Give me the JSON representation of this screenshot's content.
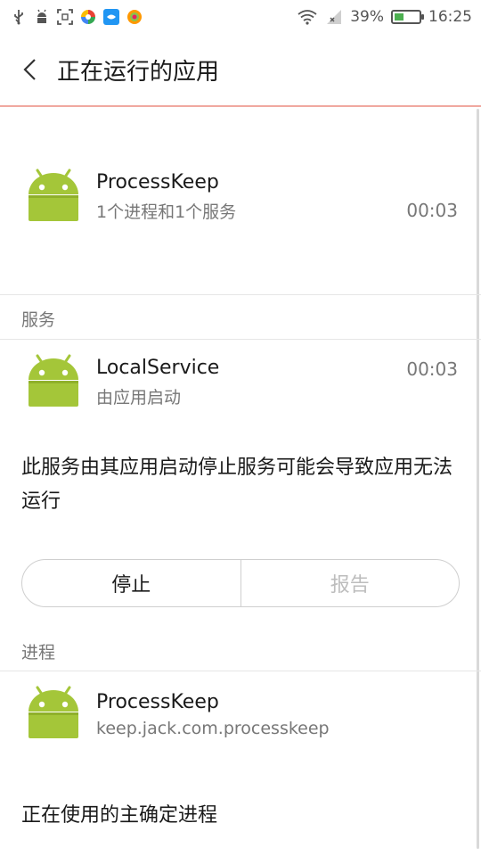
{
  "statusbar": {
    "battery_text": "39%",
    "battery_level": 0.39,
    "time": "16:25",
    "icons": [
      "usb-icon",
      "android-debug-icon",
      "screenshot-icon",
      "app-notify-icon-1",
      "app-notify-icon-2",
      "app-notify-icon-3",
      "wifi-icon",
      "signal-icon"
    ]
  },
  "header": {
    "title": "正在运行的应用"
  },
  "app": {
    "name": "ProcessKeep",
    "summary": "1个进程和1个服务",
    "time": "00:03"
  },
  "services": {
    "section_label": "服务",
    "item": {
      "name": "LocalService",
      "sub": "由应用启动",
      "time": "00:03"
    },
    "description": "此服务由其应用启动停止服务可能会导致应用无法运行",
    "stop_label": "停止",
    "report_label": "报告"
  },
  "processes": {
    "section_label": "进程",
    "item": {
      "name": "ProcessKeep",
      "sub": "keep.jack.com.processkeep"
    },
    "description": "正在使用的主确定进程"
  },
  "colors": {
    "android_green": "#a4c639",
    "accent_divider": "#f0a8a0",
    "battery_fill": "#4caf50"
  }
}
